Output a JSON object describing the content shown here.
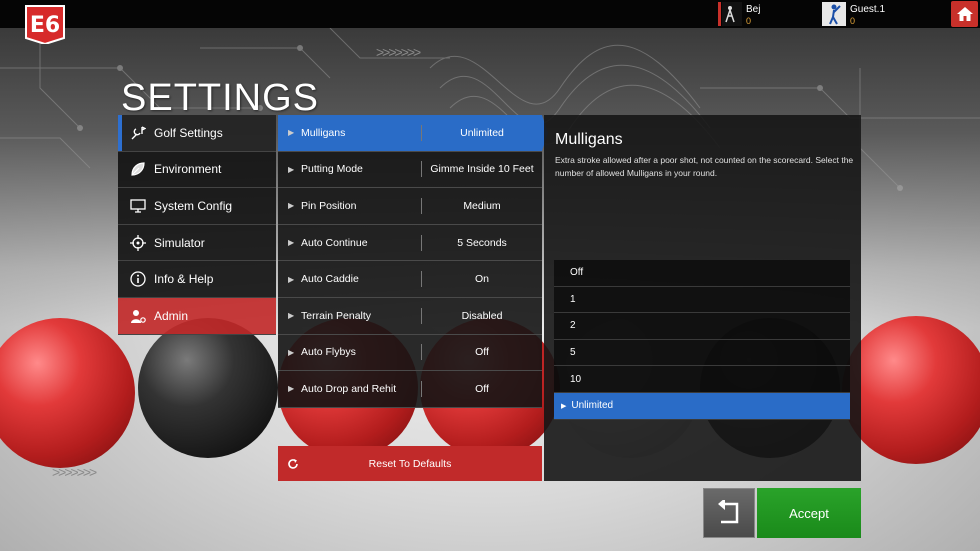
{
  "header": {
    "logo_text": "E6",
    "players": [
      {
        "name": "Bej",
        "score": "0",
        "avatar_icon": "golfer-flag-icon"
      },
      {
        "name": "Guest.1",
        "score": "0",
        "avatar_icon": "golfer-swing-icon"
      }
    ],
    "home_icon": "home-icon"
  },
  "page_title": "SETTINGS",
  "categories": [
    {
      "label": "Golf Settings",
      "icon": "golf-settings-icon",
      "active": true
    },
    {
      "label": "Environment",
      "icon": "leaf-icon"
    },
    {
      "label": "System Config",
      "icon": "monitor-icon"
    },
    {
      "label": "Simulator",
      "icon": "crosshair-icon"
    },
    {
      "label": "Info & Help",
      "icon": "info-icon"
    },
    {
      "label": "Admin",
      "icon": "admin-user-icon"
    }
  ],
  "settings": [
    {
      "name": "Mulligans",
      "value": "Unlimited",
      "active": true
    },
    {
      "name": "Putting Mode",
      "value": "Gimme Inside 10 Feet"
    },
    {
      "name": "Pin Position",
      "value": "Medium"
    },
    {
      "name": "Auto Continue",
      "value": "5 Seconds"
    },
    {
      "name": "Auto Caddie",
      "value": "On"
    },
    {
      "name": "Terrain Penalty",
      "value": "Disabled"
    },
    {
      "name": "Auto Flybys",
      "value": "Off"
    },
    {
      "name": "Auto Drop and Rehit",
      "value": "Off"
    }
  ],
  "reset_label": "Reset To Defaults",
  "detail": {
    "title": "Mulligans",
    "description": "Extra stroke allowed after a poor shot, not counted on the scorecard. Select the number of allowed Mulligans in your round.",
    "options": [
      "Off",
      "1",
      "2",
      "5",
      "10",
      "Unlimited"
    ],
    "selected": "Unlimited"
  },
  "buttons": {
    "back_icon": "undo-arrow-icon",
    "accept_label": "Accept"
  },
  "colors": {
    "accent_blue": "#2a6cc7",
    "admin_red": "#c12a2a",
    "accept_green": "#2aa32a",
    "score_orange": "#e2a43a"
  }
}
